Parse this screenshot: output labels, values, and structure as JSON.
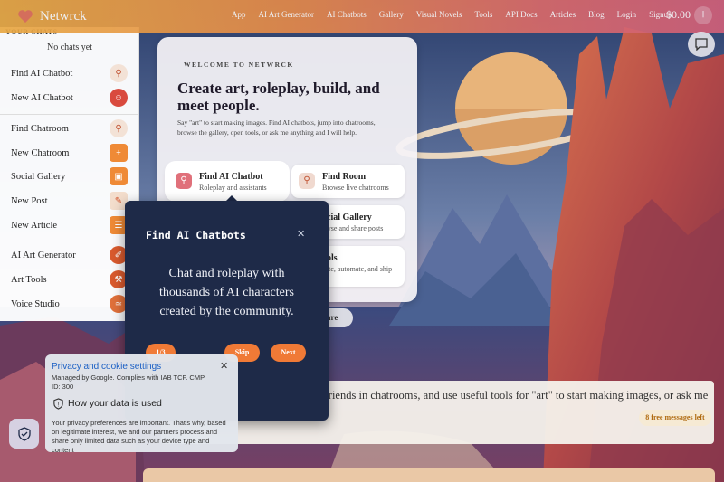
{
  "brand": "Netwrck",
  "nav": [
    "App",
    "AI Art Generator",
    "AI Chatbots",
    "Gallery",
    "Visual Novels",
    "Tools",
    "API Docs",
    "Articles",
    "Blog",
    "Login",
    "Signup"
  ],
  "cart": "$0.00",
  "sidebar": {
    "heading": "YOUR CHATS",
    "empty": "No chats yet",
    "items": [
      {
        "label": "Find AI Chatbot",
        "icon": "search-icon"
      },
      {
        "label": "New AI Chatbot",
        "icon": "robot-icon"
      },
      {
        "label": "Find Chatroom",
        "icon": "search-icon"
      },
      {
        "label": "New Chatroom",
        "icon": "plus-icon"
      },
      {
        "label": "Social Gallery",
        "icon": "gallery-icon"
      },
      {
        "label": "New Post",
        "icon": "edit-icon"
      },
      {
        "label": "New Article",
        "icon": "article-icon"
      },
      {
        "label": "AI Art Generator",
        "icon": "brush-icon"
      },
      {
        "label": "Art Tools",
        "icon": "wrench-icon"
      },
      {
        "label": "Voice Studio",
        "icon": "waveform-icon"
      }
    ]
  },
  "welcome": {
    "eyebrow": "WELCOME TO NETWRCK",
    "title": "Create art, roleplay, build, and meet people.",
    "desc": "Say \"art\" to start making images. Find AI chatbots, jump into chatrooms, browse the gallery, open tools, or ask me anything and I will help.",
    "cards": [
      {
        "title": "Find AI Chatbot",
        "sub": "Roleplay and assistants"
      },
      {
        "title": "Find Room",
        "sub": "Browse live chatrooms"
      },
      {
        "title": "ocial Gallery",
        "sub": "owse and share posts"
      },
      {
        "title": "ools",
        "sub": "eate, automate, and ship"
      },
      {
        "title": "",
        "sub": "er"
      }
    ],
    "share": "hare"
  },
  "tour": {
    "title": "Find AI Chatbots",
    "body": "Chat and roleplay with thousands of AI characters created by the community.",
    "step": "1/3",
    "skip": "Skip",
    "next": "Next"
  },
  "bottom": {
    "text": "eate art, roleplay, find AI or human friends in chatrooms, and use useful tools for \"art\" to start making images, or ask me anything and I will help.",
    "badge": "8 free messages left"
  },
  "privacy": {
    "title": "Privacy and cookie settings",
    "managed": "Managed by Google. Complies with IAB TCF. CMP ID: 300",
    "header": "How your data is used",
    "text": "Your privacy preferences are important. That's why, based on legitimate interest, we and our partners process and share only limited data such as your device type and content"
  },
  "colors": {
    "accent": "#f07a36",
    "tour_bg": "#1e2a48",
    "link": "#1a5fc4"
  }
}
